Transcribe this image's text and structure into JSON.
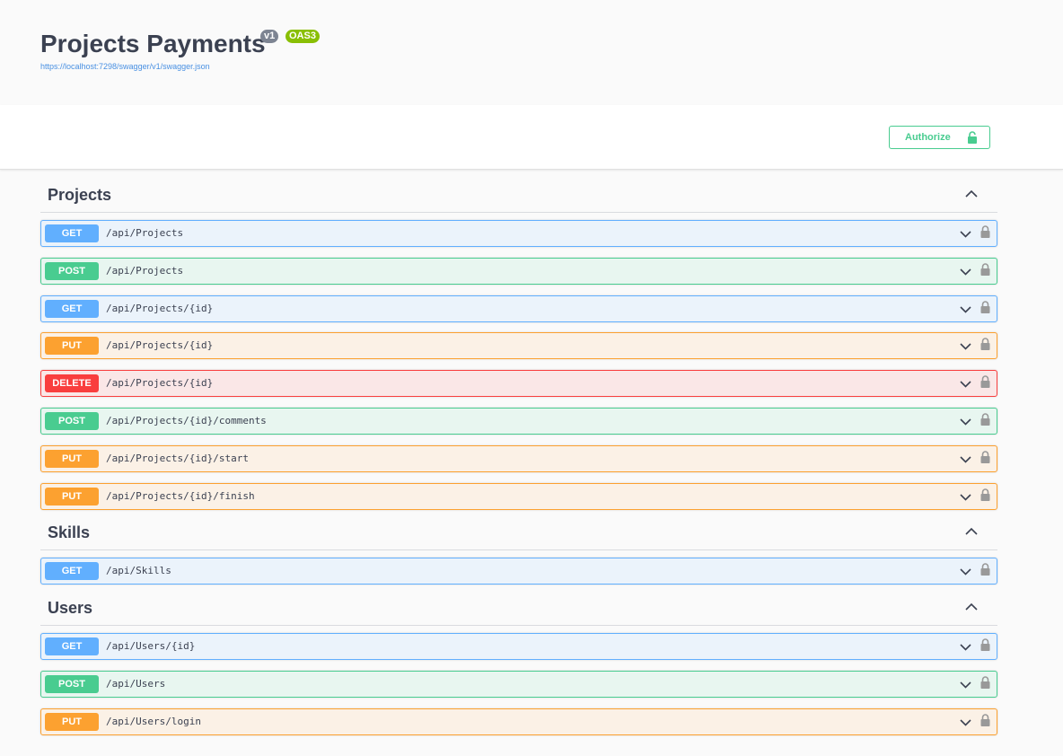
{
  "info": {
    "title": "Projects Payments",
    "version": "v1",
    "oas": "OAS3",
    "spec_url": "https://localhost:7298/swagger/v1/swagger.json"
  },
  "scheme": {
    "authorize_label": "Authorize"
  },
  "colors": {
    "get": "#61affe",
    "post": "#49cc90",
    "put": "#fca130",
    "delete": "#f93e3e"
  },
  "sections": [
    {
      "name": "Projects",
      "operations": [
        {
          "method": "GET",
          "path": "/api/Projects"
        },
        {
          "method": "POST",
          "path": "/api/Projects"
        },
        {
          "method": "GET",
          "path": "/api/Projects/{id}"
        },
        {
          "method": "PUT",
          "path": "/api/Projects/{id}"
        },
        {
          "method": "DELETE",
          "path": "/api/Projects/{id}"
        },
        {
          "method": "POST",
          "path": "/api/Projects/{id}/comments"
        },
        {
          "method": "PUT",
          "path": "/api/Projects/{id}/start"
        },
        {
          "method": "PUT",
          "path": "/api/Projects/{id}/finish"
        }
      ]
    },
    {
      "name": "Skills",
      "operations": [
        {
          "method": "GET",
          "path": "/api/Skills"
        }
      ]
    },
    {
      "name": "Users",
      "operations": [
        {
          "method": "GET",
          "path": "/api/Users/{id}"
        },
        {
          "method": "POST",
          "path": "/api/Users"
        },
        {
          "method": "PUT",
          "path": "/api/Users/login"
        }
      ]
    }
  ]
}
